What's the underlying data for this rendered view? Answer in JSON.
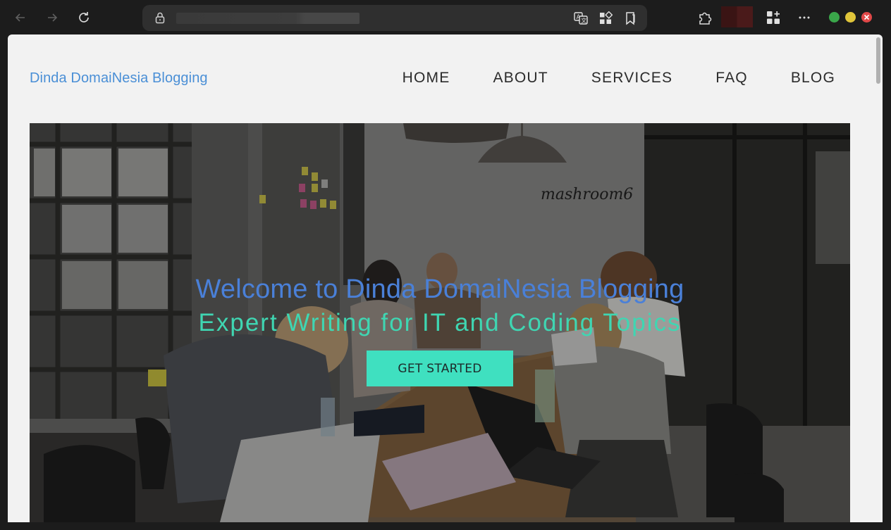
{
  "browser": {
    "back_icon": "arrow-left-icon",
    "forward_icon": "arrow-right-icon",
    "refresh_icon": "refresh-icon",
    "lock_icon": "lock-icon",
    "translate_icon": "translate-icon",
    "apps_icon": "apps-grid-icon",
    "bookmark_icon": "bookmark-icon",
    "extensions_icon": "puzzle-icon",
    "add_widget_icon": "add-grid-icon",
    "more_icon": "more-horizontal-icon",
    "window_controls": {
      "minimize_color": "#3aa64a",
      "maximize_color": "#e0c53a",
      "close_color": "#e04848"
    }
  },
  "site": {
    "brand": "Dinda DomaiNesia Blogging",
    "menu": [
      "HOME",
      "ABOUT",
      "SERVICES",
      "FAQ",
      "BLOG"
    ],
    "hero": {
      "title": "Welcome to Dinda DomaiNesia Blogging",
      "subtitle": "Expert Writing for IT and Coding Topics",
      "cta_label": "GET STARTED"
    },
    "hero_image_text": "mashroom6"
  },
  "colors": {
    "brand": "#4a8fd6",
    "hero_title": "#4a80d8",
    "hero_subtitle": "#3fd6b2",
    "cta_background": "#3fe0c0"
  }
}
